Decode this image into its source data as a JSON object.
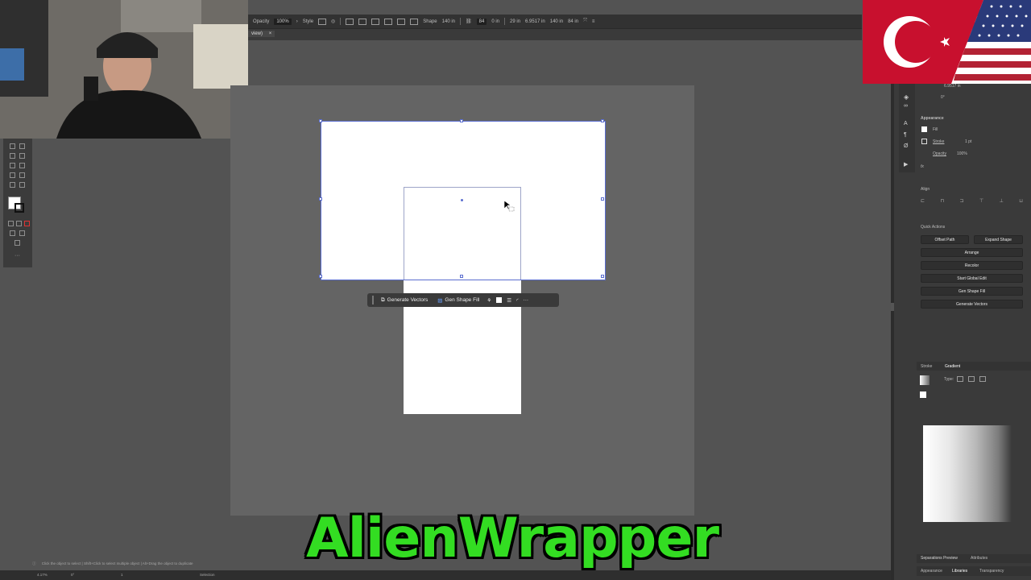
{
  "control_bar": {
    "opacity_label": "Opacity",
    "opacity_value": "100%",
    "style_label": "Style",
    "shape_label": "Shape",
    "shape_value": "140 in",
    "corner_value": "84",
    "angle_value": "0 in",
    "x_value": "29 in",
    "y_value": "6.9517 in",
    "w_value": "140 in",
    "h_value": "84 in"
  },
  "tab": {
    "close": "×",
    "name": "view)"
  },
  "context_bar": {
    "generate_vectors": "Generate Vectors",
    "gen_shape_fill": "Gen Shape Fill",
    "more": "···"
  },
  "right_panel": {
    "y_readout": "6.9517 in",
    "angle_readout": "0°",
    "appearance_title": "Appearance",
    "fill_label": "Fill",
    "stroke_label": "Stroke",
    "stroke_value": "1 pt",
    "opacity_label": "Opacity",
    "opacity_value": "100%",
    "fx_label": "fx",
    "align_title": "Align",
    "quick_actions_title": "Quick Actions",
    "offset_path": "Offset Path",
    "expand_shape": "Expand Shape",
    "arrange": "Arrange",
    "recolor": "Recolor",
    "start_global_edit": "Start Global Edit",
    "gen_shape_fill": "Gen Shape Fill",
    "generate_vectors": "Generate Vectors",
    "stroke_tab": "Stroke",
    "gradient_tab": "Gradient",
    "type_label": "Type:",
    "sep_preview_tab": "Separations Preview",
    "attributes_tab": "Attributes",
    "appearance_tab": "Appearance",
    "libraries_tab": "Libraries",
    "transparency_tab": "Transparency"
  },
  "status": {
    "hint": "Click the object to select  |  Shift+Click to select multiple object  |  Alt+Drag the object to duplicate",
    "zoom": "4.17%",
    "rotate": "0°",
    "page": "1",
    "tool": "Selection"
  },
  "brand": {
    "text": "AlienWrapper"
  },
  "colors": {
    "accent": "#5a6dcf",
    "brand": "#33dd22"
  }
}
